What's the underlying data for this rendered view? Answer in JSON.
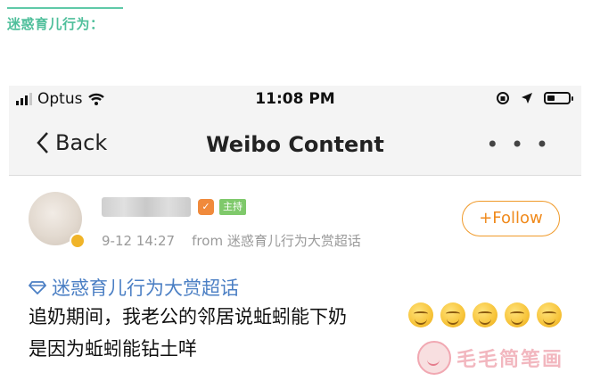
{
  "header": {
    "title": "迷惑育儿行为："
  },
  "statusbar": {
    "carrier": "Optus",
    "time": "11:08 PM"
  },
  "navbar": {
    "back_label": "Back",
    "title": "Weibo Content",
    "more_label": "• • •"
  },
  "post": {
    "role_badge": "主持",
    "timestamp": "9-12 14:27",
    "source": "from 迷惑育儿行为大赏超话",
    "follow_label": "+Follow",
    "topic": "迷惑育儿行为大赏超话",
    "line1": "追奶期间，我老公的邻居说蚯蚓能下奶",
    "line2": "是因为蚯蚓能钻土咩",
    "emoji_count": 5
  },
  "watermark": {
    "text": "毛毛简笔画"
  },
  "colors": {
    "accent": "#4fbf9b",
    "follow": "#f08a1c",
    "topic_link": "#4b7fc4"
  }
}
